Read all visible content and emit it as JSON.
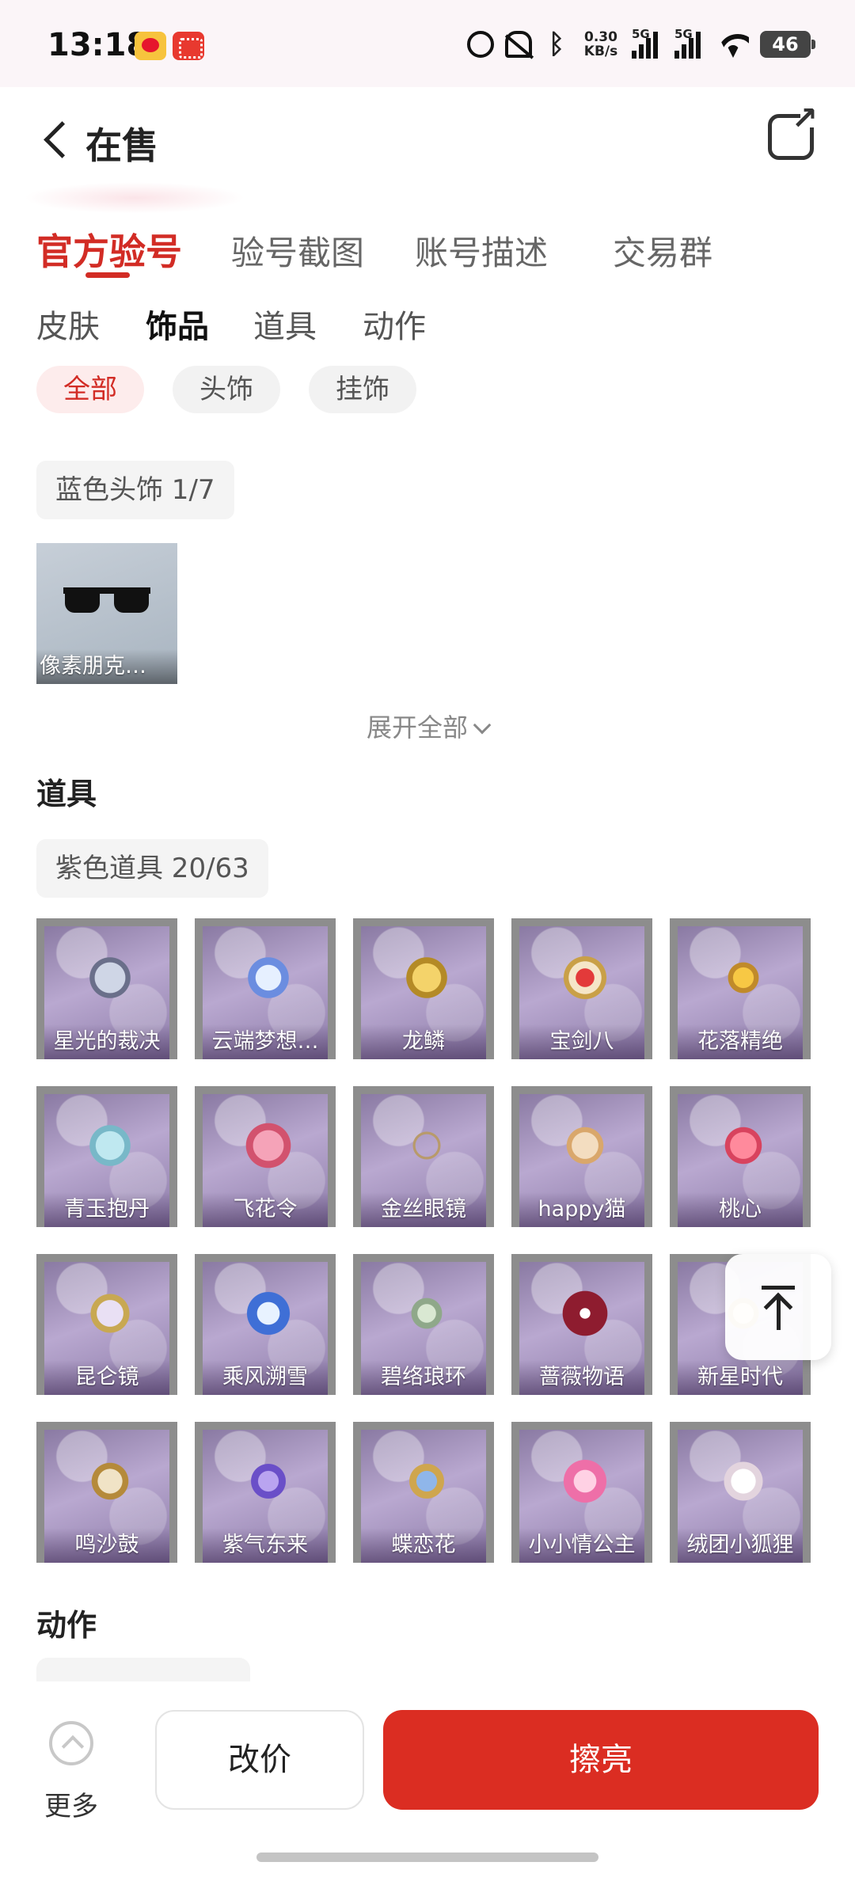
{
  "status_bar": {
    "time": "13:18",
    "net_speed_value": "0.30",
    "net_speed_unit": "KB/s",
    "signal_label_1": "5G",
    "signal_label_2": "5G",
    "battery": "46",
    "icons": [
      "weibo-icon",
      "red-app-icon",
      "alarm-icon",
      "mute-icon",
      "bluetooth-icon",
      "signal-icon",
      "wifi-icon",
      "battery-icon"
    ]
  },
  "header": {
    "title": "在售"
  },
  "main_tabs": [
    "官方验号",
    "验号截图",
    "账号描述",
    "交易群"
  ],
  "sub_tabs": [
    "皮肤",
    "饰品",
    "道具",
    "动作"
  ],
  "filter_chips": [
    "全部",
    "头饰",
    "挂饰"
  ],
  "accessories": {
    "group_label": "蓝色头饰 1/7",
    "items": [
      {
        "name": "像素朋克…"
      }
    ],
    "expand_label": "展开全部"
  },
  "props": {
    "title": "道具",
    "group_label": "紫色道具 20/63",
    "items": [
      {
        "name": "星光的裁决"
      },
      {
        "name": "云端梦想…"
      },
      {
        "name": "龙鳞"
      },
      {
        "name": "宝剑八"
      },
      {
        "name": "花落精绝"
      },
      {
        "name": "青玉抱丹"
      },
      {
        "name": "飞花令"
      },
      {
        "name": "金丝眼镜"
      },
      {
        "name": "happy猫"
      },
      {
        "name": "桃心"
      },
      {
        "name": "昆仑镜"
      },
      {
        "name": "乘风溯雪"
      },
      {
        "name": "碧络琅环"
      },
      {
        "name": "蔷薇物语"
      },
      {
        "name": "新星时代"
      },
      {
        "name": "鸣沙鼓"
      },
      {
        "name": "紫气东来"
      },
      {
        "name": "蝶恋花"
      },
      {
        "name": "小小情公主"
      },
      {
        "name": "绒团小狐狸"
      }
    ]
  },
  "actions": {
    "title": "动作"
  },
  "bottom_bar": {
    "more_label": "更多",
    "reprice_label": "改价",
    "polish_label": "擦亮"
  },
  "colors": {
    "accent": "#d22c25",
    "primary_button": "#db2d22",
    "chip_active_bg": "#fdecec"
  }
}
